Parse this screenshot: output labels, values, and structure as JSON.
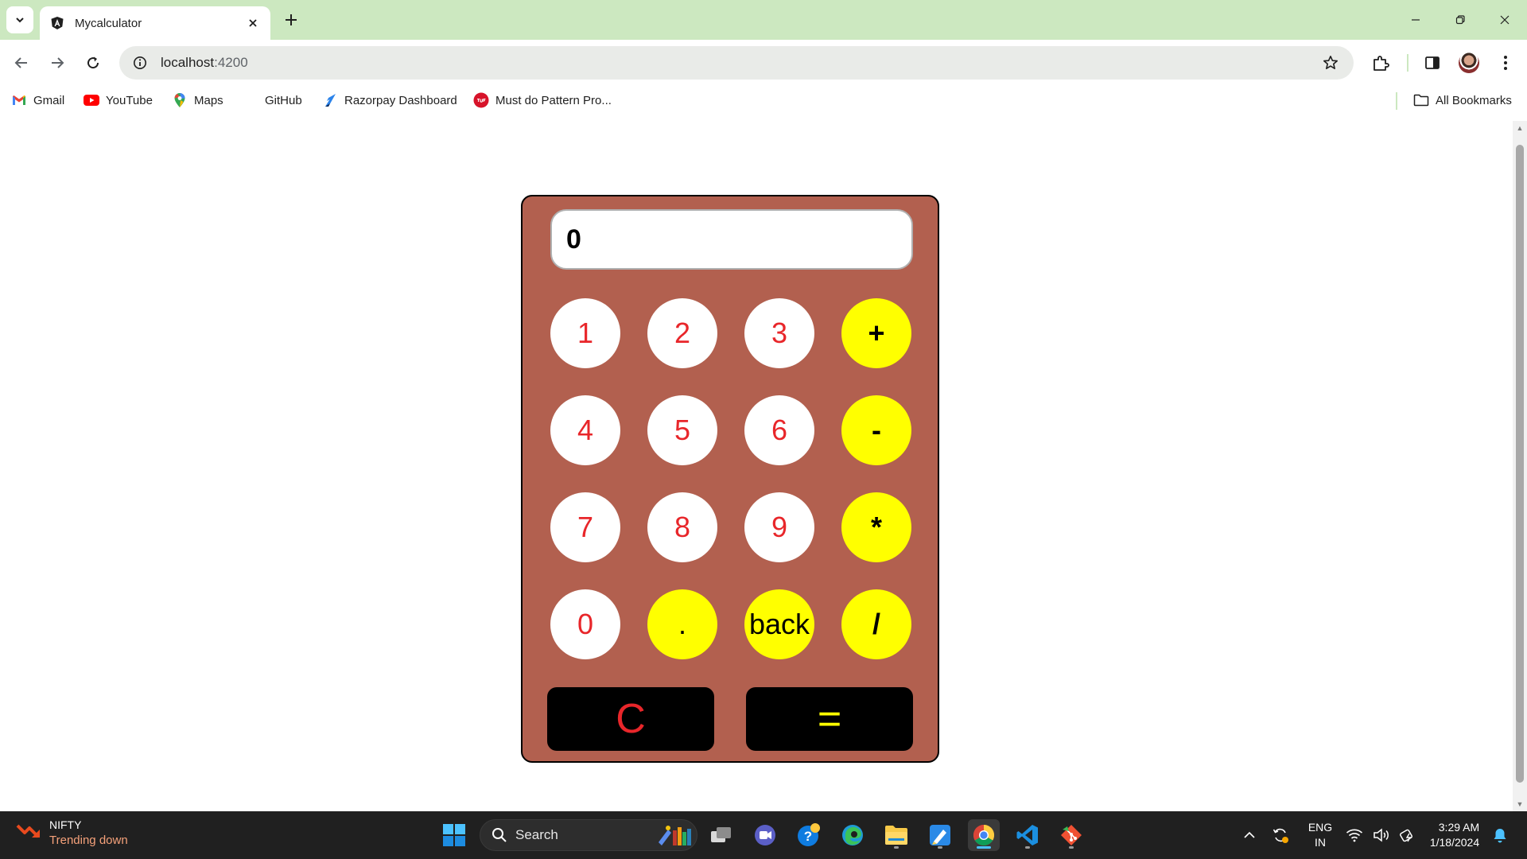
{
  "browser": {
    "tab": {
      "title": "Mycalculator"
    },
    "address": {
      "host": "localhost",
      "port": ":4200"
    },
    "bookmarks": [
      {
        "label": "Gmail",
        "icon": "gmail-icon"
      },
      {
        "label": "YouTube",
        "icon": "youtube-icon"
      },
      {
        "label": "Maps",
        "icon": "maps-icon"
      },
      {
        "label": "GitHub",
        "icon": "github-icon"
      },
      {
        "label": "Razorpay Dashboard",
        "icon": "razorpay-icon"
      },
      {
        "label": "Must do Pattern Pro...",
        "icon": "tuf-icon"
      }
    ],
    "all_bookmarks_label": "All Bookmarks"
  },
  "calculator": {
    "display": "0",
    "keys": [
      {
        "label": "1",
        "kind": "number"
      },
      {
        "label": "2",
        "kind": "number"
      },
      {
        "label": "3",
        "kind": "number"
      },
      {
        "label": "+",
        "kind": "operator"
      },
      {
        "label": "4",
        "kind": "number"
      },
      {
        "label": "5",
        "kind": "number"
      },
      {
        "label": "6",
        "kind": "number"
      },
      {
        "label": "-",
        "kind": "operator"
      },
      {
        "label": "7",
        "kind": "number"
      },
      {
        "label": "8",
        "kind": "number"
      },
      {
        "label": "9",
        "kind": "number"
      },
      {
        "label": "*",
        "kind": "operator"
      },
      {
        "label": "0",
        "kind": "number"
      },
      {
        "label": ".",
        "kind": "operator"
      },
      {
        "label": "back",
        "kind": "operator"
      },
      {
        "label": "/",
        "kind": "operator"
      }
    ],
    "clear_label": "C",
    "equals_label": "=",
    "colors": {
      "body": "#b2604f",
      "number_key_bg": "#ffffff",
      "number_key_text": "#e8262a",
      "operator_key_bg": "#ffff00",
      "clear_text": "#e8262a",
      "equals_text": "#ffff00"
    }
  },
  "taskbar": {
    "widget": {
      "title": "NIFTY",
      "subtitle": "Trending down"
    },
    "search_label": "Search",
    "language": {
      "line1": "ENG",
      "line2": "IN"
    },
    "clock": {
      "time": "3:29 AM",
      "date": "1/18/2024"
    }
  }
}
